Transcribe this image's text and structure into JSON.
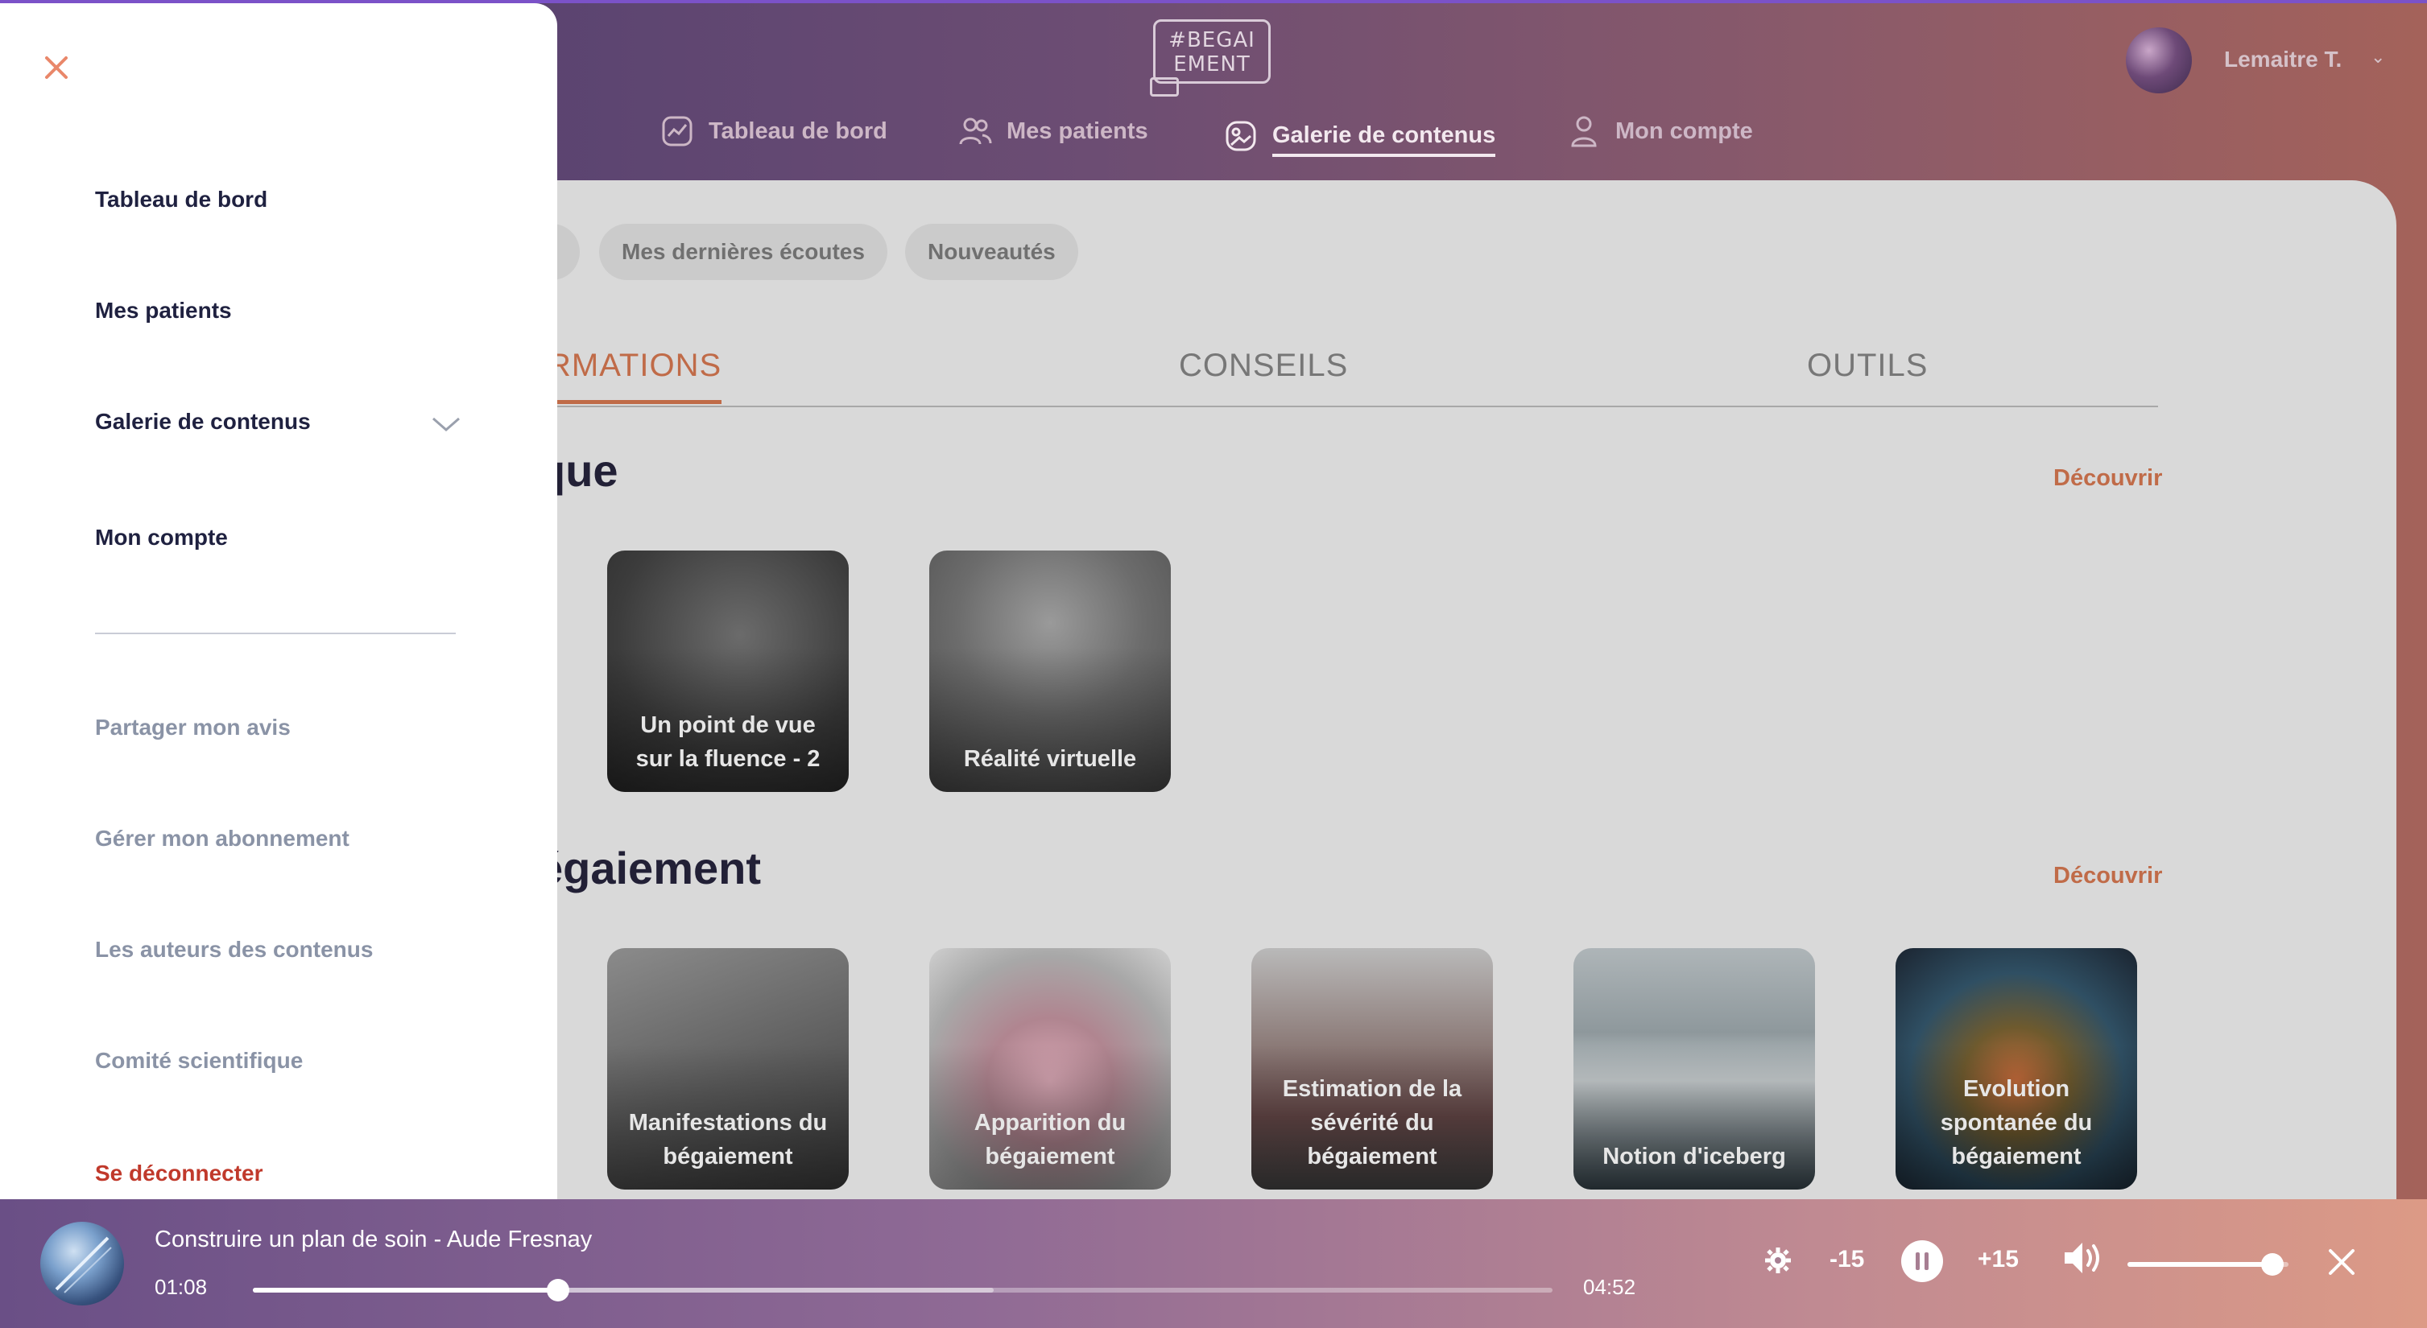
{
  "header": {
    "logo_text": "#BEGAIEMENT",
    "user_name": "Lemaitre T.",
    "nav": [
      {
        "label": "Tableau de bord",
        "icon": "chart-icon"
      },
      {
        "label": "Mes patients",
        "icon": "users-icon"
      },
      {
        "label": "Galerie de contenus",
        "icon": "gallery-icon",
        "active": true
      },
      {
        "label": "Mon compte",
        "icon": "user-icon"
      }
    ]
  },
  "main": {
    "chips": [
      "Mes dernières écoutes",
      "Nouveautés"
    ],
    "category_tabs": [
      {
        "label": "RMATIONS",
        "active": true
      },
      {
        "label": "CONSEILS"
      },
      {
        "label": "OUTILS"
      }
    ],
    "sections": [
      {
        "title": "que",
        "discover_label": "Découvrir",
        "cards": [
          {
            "title": "Un point de vue sur la fluence - 2"
          },
          {
            "title": "Réalité virtuelle"
          }
        ]
      },
      {
        "title": "égaiement",
        "discover_label": "Découvrir",
        "cards": [
          {
            "title": "Manifestations du bégaiement"
          },
          {
            "title": "Apparition du bégaiement"
          },
          {
            "title": "Estimation de la sévérité du bégaiement"
          },
          {
            "title": "Notion d'iceberg"
          },
          {
            "title": "Evolution spontanée du bégaiement"
          }
        ]
      }
    ]
  },
  "side_menu": {
    "primary": [
      {
        "label": "Tableau de bord"
      },
      {
        "label": "Mes patients"
      },
      {
        "label": "Galerie de contenus",
        "expandable": true
      },
      {
        "label": "Mon compte"
      }
    ],
    "secondary": [
      {
        "label": "Partager mon avis"
      },
      {
        "label": "Gérer mon abonnement"
      },
      {
        "label": "Les auteurs des contenus"
      },
      {
        "label": "Comité scientifique"
      }
    ],
    "logout_label": "Se déconnecter"
  },
  "player": {
    "title": "Construire un plan de soin - Aude Fresnay",
    "current_time": "01:08",
    "total_time": "04:52",
    "progress": 0.235,
    "buffered": 0.57,
    "rewind_label": "-15",
    "forward_label": "+15",
    "volume": 0.9
  },
  "colors": {
    "accent": "#c06b48",
    "logout": "#c0392b",
    "menu_text": "#1f2140",
    "menu_sub_text": "#8a93a6"
  }
}
